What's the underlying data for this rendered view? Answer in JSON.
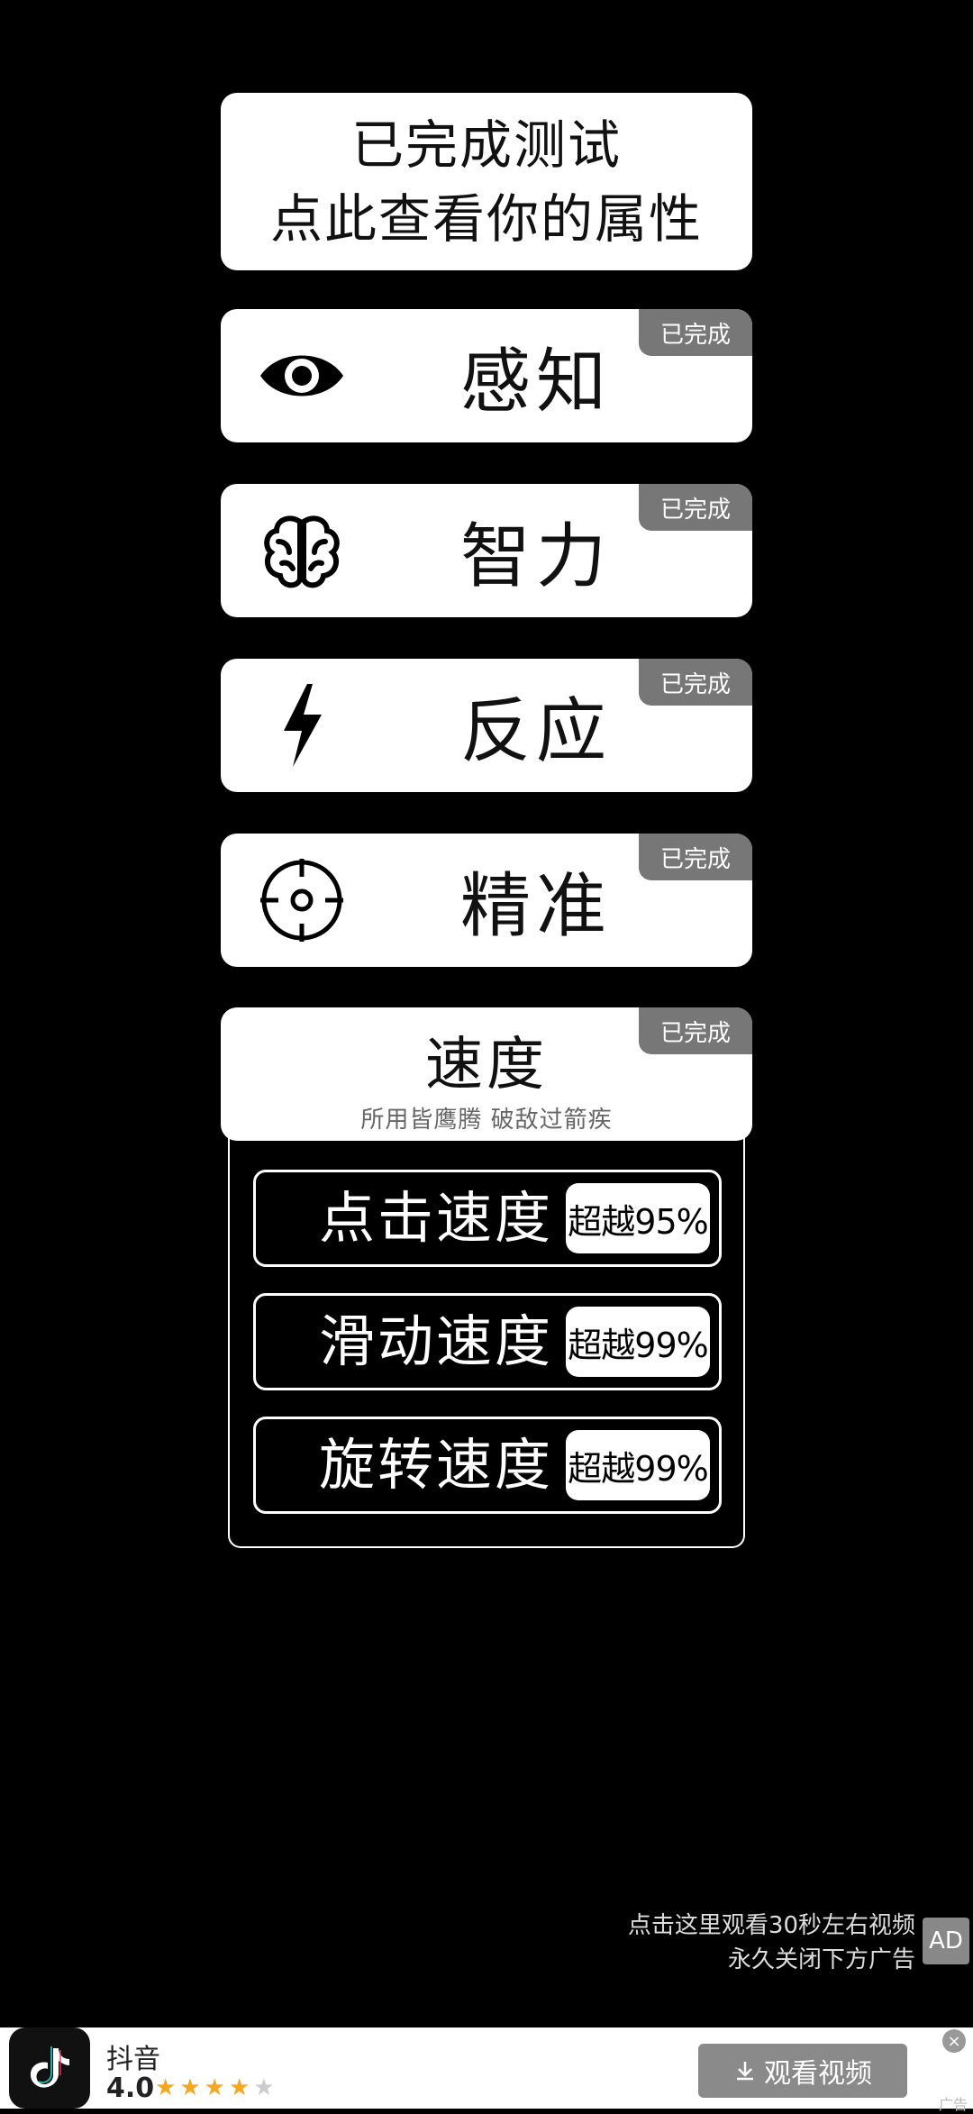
{
  "header": {
    "line1": "已完成测试",
    "line2": "点此查看你的属性"
  },
  "categories": [
    {
      "label": "感知",
      "badge": "已完成",
      "icon": "eye-icon"
    },
    {
      "label": "智力",
      "badge": "已完成",
      "icon": "brain-icon"
    },
    {
      "label": "反应",
      "badge": "已完成",
      "icon": "lightning-icon"
    },
    {
      "label": "精准",
      "badge": "已完成",
      "icon": "crosshair-icon"
    }
  ],
  "speed": {
    "title": "速度",
    "subtitle": "所用皆鹰腾 破敌过箭疾",
    "badge": "已完成",
    "rows": [
      {
        "name": "点击速度",
        "value": "超越95%"
      },
      {
        "name": "滑动速度",
        "value": "超越99%"
      },
      {
        "name": "旋转速度",
        "value": "超越99%"
      }
    ]
  },
  "ad": {
    "hint_line1": "点击这里观看30秒左右视频",
    "hint_line2": "永久关闭下方广告",
    "ad_mark": "AD",
    "app_name": "抖音",
    "rating": "4.0",
    "stars_filled": 4,
    "stars_total": 5,
    "cta_label": "观看视频",
    "tag": "广告"
  },
  "colors": {
    "background": "#000000",
    "card": "#ffffff",
    "badge": "#777777",
    "star": "#f5a623"
  }
}
